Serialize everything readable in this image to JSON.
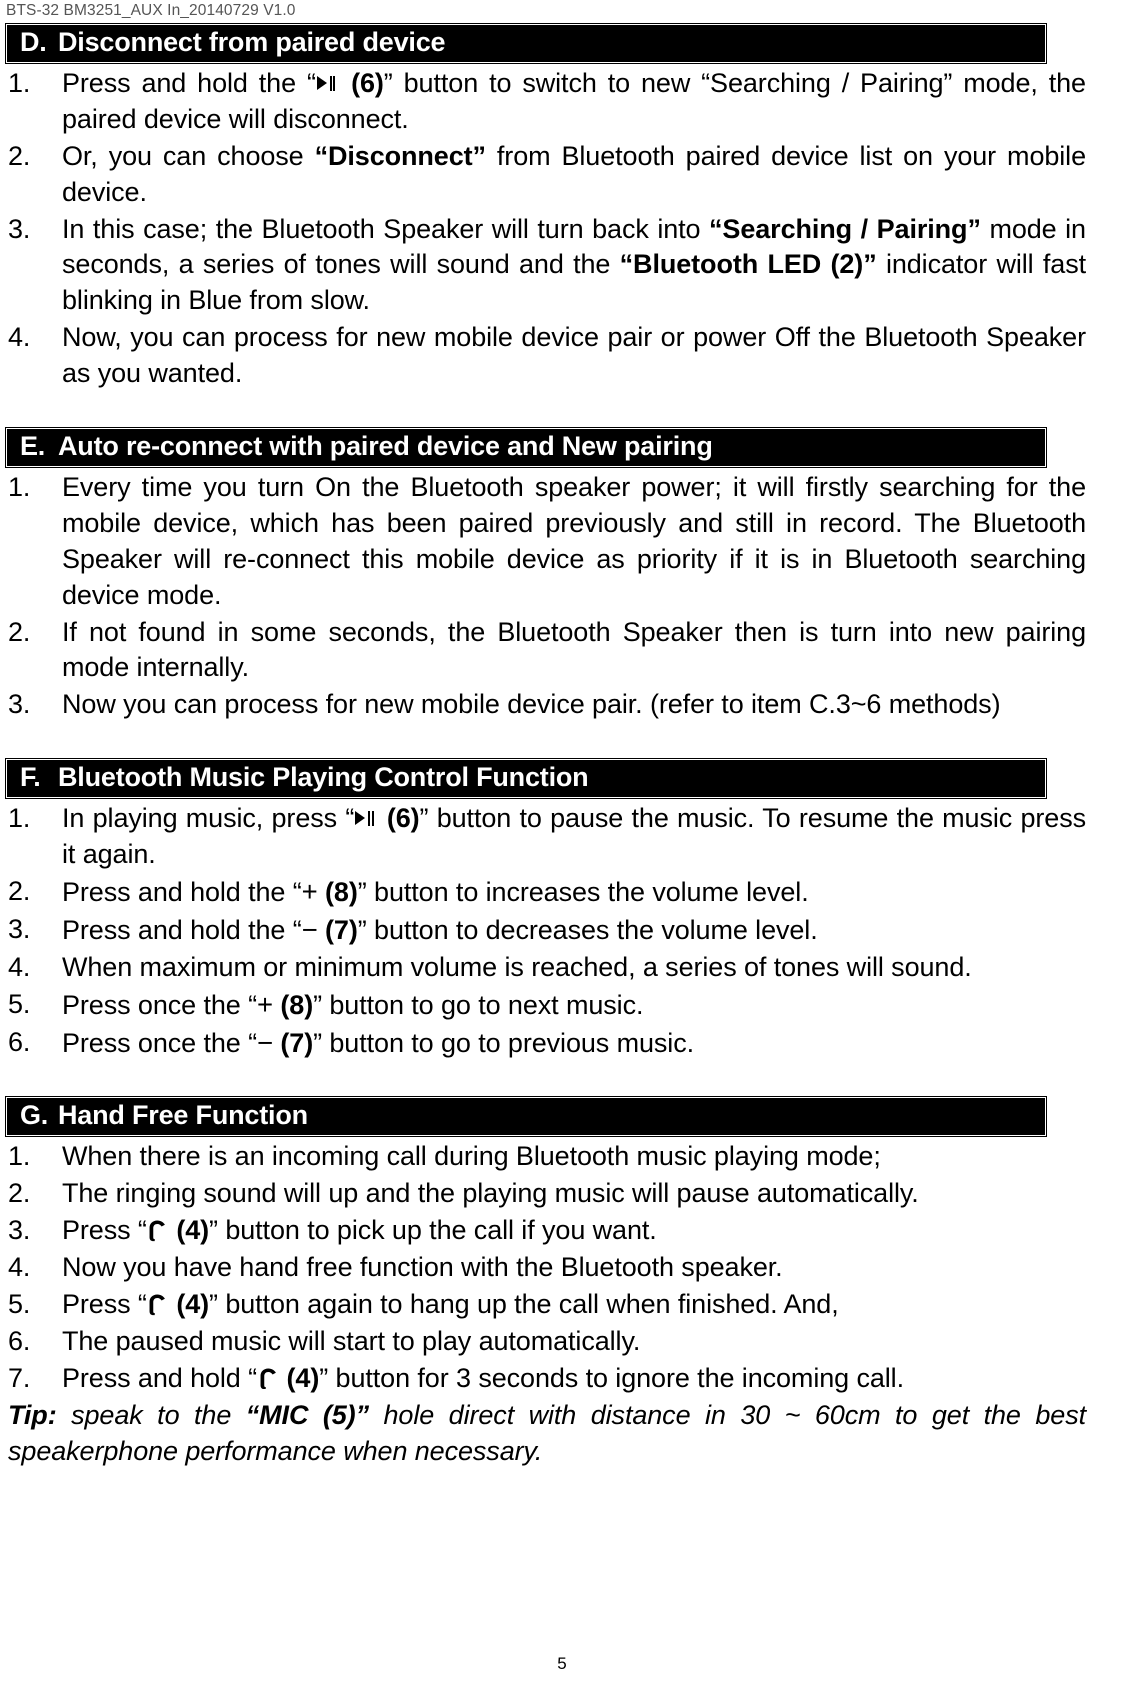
{
  "header": {
    "doc_id": "BTS-32 BM3251_AUX In_20140729 V1.0"
  },
  "footer": {
    "page_number": "5"
  },
  "icons": {
    "play_pause": "play-pause-icon",
    "plus": "+",
    "minus": "−",
    "phone": "phone-handset-icon"
  },
  "sections": [
    {
      "letter": "D.",
      "title": "Disconnect from paired device",
      "steps": [
        {
          "num": "1.",
          "parts": [
            {
              "t": "text",
              "v": "Press and hold the “"
            },
            {
              "t": "icon",
              "v": "play_pause"
            },
            {
              "t": "bold",
              "v": " (6)"
            },
            {
              "t": "text",
              "v": "” button to switch to new “Searching / Pairing” mode, the paired device will disconnect."
            }
          ]
        },
        {
          "num": "2.",
          "parts": [
            {
              "t": "text",
              "v": "Or, you can choose "
            },
            {
              "t": "bold",
              "v": "“Disconnect”"
            },
            {
              "t": "text",
              "v": " from Bluetooth paired device list on your mobile device."
            }
          ]
        },
        {
          "num": "3.",
          "parts": [
            {
              "t": "text",
              "v": "In this case; the Bluetooth Speaker will turn back into "
            },
            {
              "t": "bold",
              "v": "“Searching / Pairing”"
            },
            {
              "t": "text",
              "v": " mode in seconds, a series of tones will sound and the "
            },
            {
              "t": "bold",
              "v": "“Bluetooth LED (2)”"
            },
            {
              "t": "text",
              "v": " indicator will fast blinking in Blue from slow."
            }
          ]
        },
        {
          "num": "4.",
          "parts": [
            {
              "t": "text",
              "v": "Now, you can process for new mobile device pair or power Off the Bluetooth Speaker as you wanted."
            }
          ]
        }
      ]
    },
    {
      "letter": "E.",
      "title": "Auto re-connect with paired device and New pairing",
      "steps": [
        {
          "num": "1.",
          "parts": [
            {
              "t": "text",
              "v": "Every time you turn On the Bluetooth speaker power; it will firstly searching for the mobile device, which has been paired previously and still in record. The Bluetooth Speaker will re-connect this mobile device as priority if it is in Bluetooth searching device mode."
            }
          ]
        },
        {
          "num": "2.",
          "parts": [
            {
              "t": "text",
              "v": "If not found in some seconds, the Bluetooth Speaker then is turn into new pairing mode internally."
            }
          ]
        },
        {
          "num": "3.",
          "parts": [
            {
              "t": "text",
              "v": "Now you can process for new mobile device pair. (refer to item C.3~6 methods)"
            }
          ]
        }
      ]
    },
    {
      "letter": "F.",
      "title": "Bluetooth Music Playing Control Function",
      "steps": [
        {
          "num": "1.",
          "parts": [
            {
              "t": "text",
              "v": "In playing music, press “"
            },
            {
              "t": "icon",
              "v": "play_pause"
            },
            {
              "t": "bold",
              "v": " (6)"
            },
            {
              "t": "text",
              "v": "” button to pause the music. To resume the music press it again."
            }
          ]
        },
        {
          "num": "2.",
          "parts": [
            {
              "t": "text",
              "v": "Press and hold the “"
            },
            {
              "t": "icon",
              "v": "plus"
            },
            {
              "t": "bold",
              "v": " (8)"
            },
            {
              "t": "text",
              "v": "” button to increases the volume level."
            }
          ]
        },
        {
          "num": "3.",
          "parts": [
            {
              "t": "text",
              "v": "Press and hold the “"
            },
            {
              "t": "icon",
              "v": "minus"
            },
            {
              "t": "bold",
              "v": " (7)"
            },
            {
              "t": "text",
              "v": "” button to decreases the volume level."
            }
          ]
        },
        {
          "num": "4.",
          "parts": [
            {
              "t": "text",
              "v": "When maximum or minimum volume is reached, a series of tones will sound."
            }
          ]
        },
        {
          "num": "5.",
          "parts": [
            {
              "t": "text",
              "v": "Press once the “"
            },
            {
              "t": "icon",
              "v": "plus"
            },
            {
              "t": "bold",
              "v": " (8)"
            },
            {
              "t": "text",
              "v": "” button to go to next music."
            }
          ]
        },
        {
          "num": "6.",
          "parts": [
            {
              "t": "text",
              "v": "Press once the “"
            },
            {
              "t": "icon",
              "v": "minus"
            },
            {
              "t": "bold",
              "v": " (7)"
            },
            {
              "t": "text",
              "v": "” button to go to previous music."
            }
          ]
        }
      ]
    },
    {
      "letter": "G.",
      "title": "Hand Free Function",
      "steps": [
        {
          "num": "1.",
          "parts": [
            {
              "t": "text",
              "v": "When there is an incoming call during Bluetooth music playing mode;"
            }
          ]
        },
        {
          "num": "2.",
          "parts": [
            {
              "t": "text",
              "v": "The ringing sound will up and the playing music will pause automatically."
            }
          ]
        },
        {
          "num": "3.",
          "parts": [
            {
              "t": "text",
              "v": "Press “"
            },
            {
              "t": "icon",
              "v": "phone"
            },
            {
              "t": "bold",
              "v": " (4)"
            },
            {
              "t": "text",
              "v": "” button to pick up the call if you want."
            }
          ]
        },
        {
          "num": "4.",
          "parts": [
            {
              "t": "text",
              "v": "Now you have hand free function with the Bluetooth speaker."
            }
          ]
        },
        {
          "num": "5.",
          "parts": [
            {
              "t": "text",
              "v": "Press “"
            },
            {
              "t": "icon",
              "v": "phone"
            },
            {
              "t": "bold",
              "v": " (4)"
            },
            {
              "t": "text",
              "v": "” button again to hang up the call when finished. And,"
            }
          ]
        },
        {
          "num": "6.",
          "parts": [
            {
              "t": "text",
              "v": "The paused music will start to play automatically."
            }
          ]
        },
        {
          "num": "7.",
          "parts": [
            {
              "t": "text",
              "v": "Press and hold “"
            },
            {
              "t": "icon",
              "v": "phone"
            },
            {
              "t": "bold",
              "v": " (4)"
            },
            {
              "t": "text",
              "v": "” button for 3 seconds to ignore the incoming call."
            }
          ]
        }
      ]
    }
  ],
  "tip": {
    "label": "Tip:",
    "parts": [
      {
        "t": "text",
        "v": " speak to the "
      },
      {
        "t": "bold",
        "v": "“MIC (5)”"
      },
      {
        "t": "text",
        "v": " hole direct with distance in 30 ~ 60cm to get the best speakerphone performance when necessary."
      }
    ]
  }
}
